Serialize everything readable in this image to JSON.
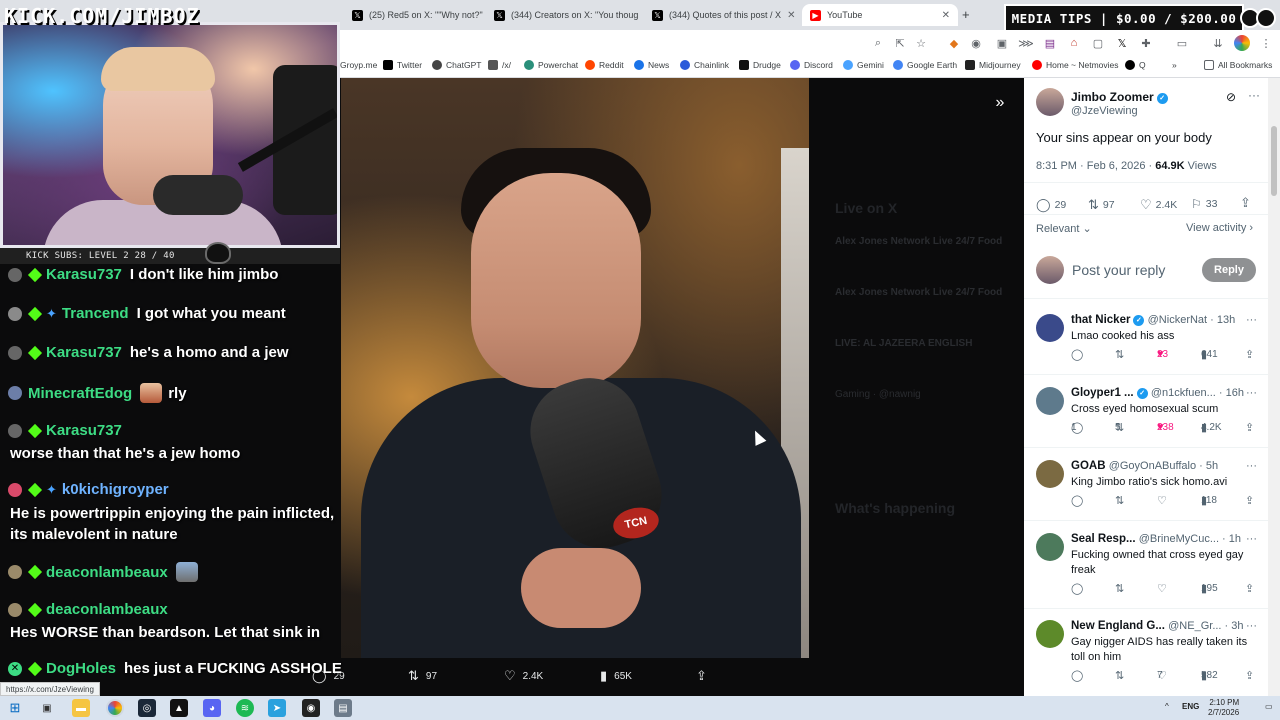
{
  "overlay": {
    "brand": "KICK.COM/JIMBOZ",
    "subs_label": "KICK SUBS: LEVEL 2 28 / 40",
    "media_tips": "MEDIA TIPS | $0.00 / $200.00"
  },
  "browser": {
    "tabs": [
      {
        "title": "(25) Red5 on X: \"\"Why not?\" -",
        "icon": "x-icon"
      },
      {
        "title": "(344) Creators on X: \"You thoug",
        "icon": "x-icon"
      },
      {
        "title": "(344) Quotes of this post / X",
        "icon": "x-icon"
      },
      {
        "title": "YouTube",
        "icon": "youtube-icon"
      }
    ],
    "bookmarks": [
      "Groyp.me",
      "Twitter",
      "ChatGPT",
      "/x/",
      "Powerchat",
      "Reddit",
      "News",
      "Chainlink",
      "Drudge",
      "Discord",
      "Gemini",
      "Google Earth",
      "Midjourney",
      "Home ~ Netmovies",
      "Q"
    ],
    "all_bookmarks": "All Bookmarks",
    "status_url": "https://x.com/JzeViewing"
  },
  "chat": [
    {
      "user": "Karasu737",
      "color": "#3ddc84",
      "text": "I don't like him jimbo",
      "sword": false
    },
    {
      "user": "Trancend",
      "color": "#3ddc84",
      "text": "I got what you meant",
      "sword": true
    },
    {
      "user": "Karasu737",
      "color": "#3ddc84",
      "text": "he's a homo and a jew",
      "sword": false
    },
    {
      "user": "MinecraftEdog",
      "color": "#3ddc84",
      "text": "rly",
      "sword": false
    },
    {
      "user": "Karasu737",
      "color": "#3ddc84",
      "text": "",
      "sword": false,
      "cont": "worse than that he's a jew homo"
    },
    {
      "user": "k0kichigroyper",
      "color": "#6fb3ff",
      "text": "",
      "sword": true,
      "cont": "He is powertrippin enjoying the pain inflicted,",
      "cont2": "its malevolent in nature"
    },
    {
      "user": "deaconlambeaux",
      "color": "#3ddc84",
      "text": "",
      "sword": false
    },
    {
      "user": "deaconlambeaux",
      "color": "#3ddc84",
      "text": "",
      "sword": false,
      "cont": "Hes WORSE than beardson. Let that sink in"
    },
    {
      "user": "DogHoles",
      "color": "#3ddc84",
      "text": "hes just a FUCKING ASSHOLE",
      "sword": false
    }
  ],
  "video_actions": {
    "replies": "29",
    "reposts": "97",
    "likes": "2.4K",
    "views": "65K"
  },
  "dim_x": {
    "live_on_x": "Live on X",
    "whats_happening": "What's happening",
    "live1": "Alex Jones Network Live 24/7 Food",
    "live2": "LIVE: AL JAZEERA ENGLISH",
    "live3": "Gaming · @nawnig"
  },
  "post": {
    "author": "Jimbo Zoomer",
    "handle": "@JzeViewing",
    "text": "Your sins appear on your body",
    "time": "8:31 PM · Feb 6, 2026 ·",
    "views": "64.9K",
    "views_label": "Views",
    "replies": "29",
    "reposts": "97",
    "likes": "2.4K",
    "bookmarks": "33",
    "sort": "Relevant",
    "view_activity": "View activity",
    "reply_placeholder": "Post your reply",
    "reply_button": "Reply"
  },
  "replies": [
    {
      "name": "that Nicker",
      "verified": true,
      "handle": "@NickerNat · 13h",
      "text": "Lmao cooked his ass",
      "comments": "",
      "reposts": "",
      "likes": "23",
      "liked": true,
      "views": "641",
      "avatar": "#3a4a8a"
    },
    {
      "name": "Gloyper1 ...",
      "verified": true,
      "handle": "@n1ckfuen... · 16h",
      "text": "Cross eyed homosexual scum",
      "comments": "1",
      "reposts": "5",
      "likes": "238",
      "liked": true,
      "views": "4.2K",
      "avatar": "#5e7a8c"
    },
    {
      "name": "GOAB",
      "verified": false,
      "handle": "@GoyOnABuffalo · 5h",
      "text": "King Jimbo ratio's sick homo.avi",
      "comments": "",
      "reposts": "",
      "likes": "",
      "liked": false,
      "views": "118",
      "avatar": "#7b6a42"
    },
    {
      "name": "Seal Resp...",
      "verified": false,
      "handle": "@BrineMyCuc... · 1h",
      "text": "Fucking owned that cross eyed gay freak",
      "comments": "",
      "reposts": "",
      "likes": "",
      "liked": false,
      "views": "195",
      "avatar": "#4d7a5c"
    },
    {
      "name": "New England G...",
      "verified": false,
      "handle": "@NE_Gr... · 3h",
      "text": "Gay nigger AIDS has really taken its toll on him",
      "comments": "",
      "reposts": "",
      "likes": "7",
      "liked": false,
      "views": "582",
      "avatar": "#5d8a2a"
    }
  ],
  "taskbar": {
    "lang": "ENG",
    "time": "2:10 PM",
    "date": "2/7/2026"
  },
  "colors": {
    "x_blue": "#1d9bf0",
    "like_pink": "#f91880",
    "kick_green": "#53fc18"
  }
}
